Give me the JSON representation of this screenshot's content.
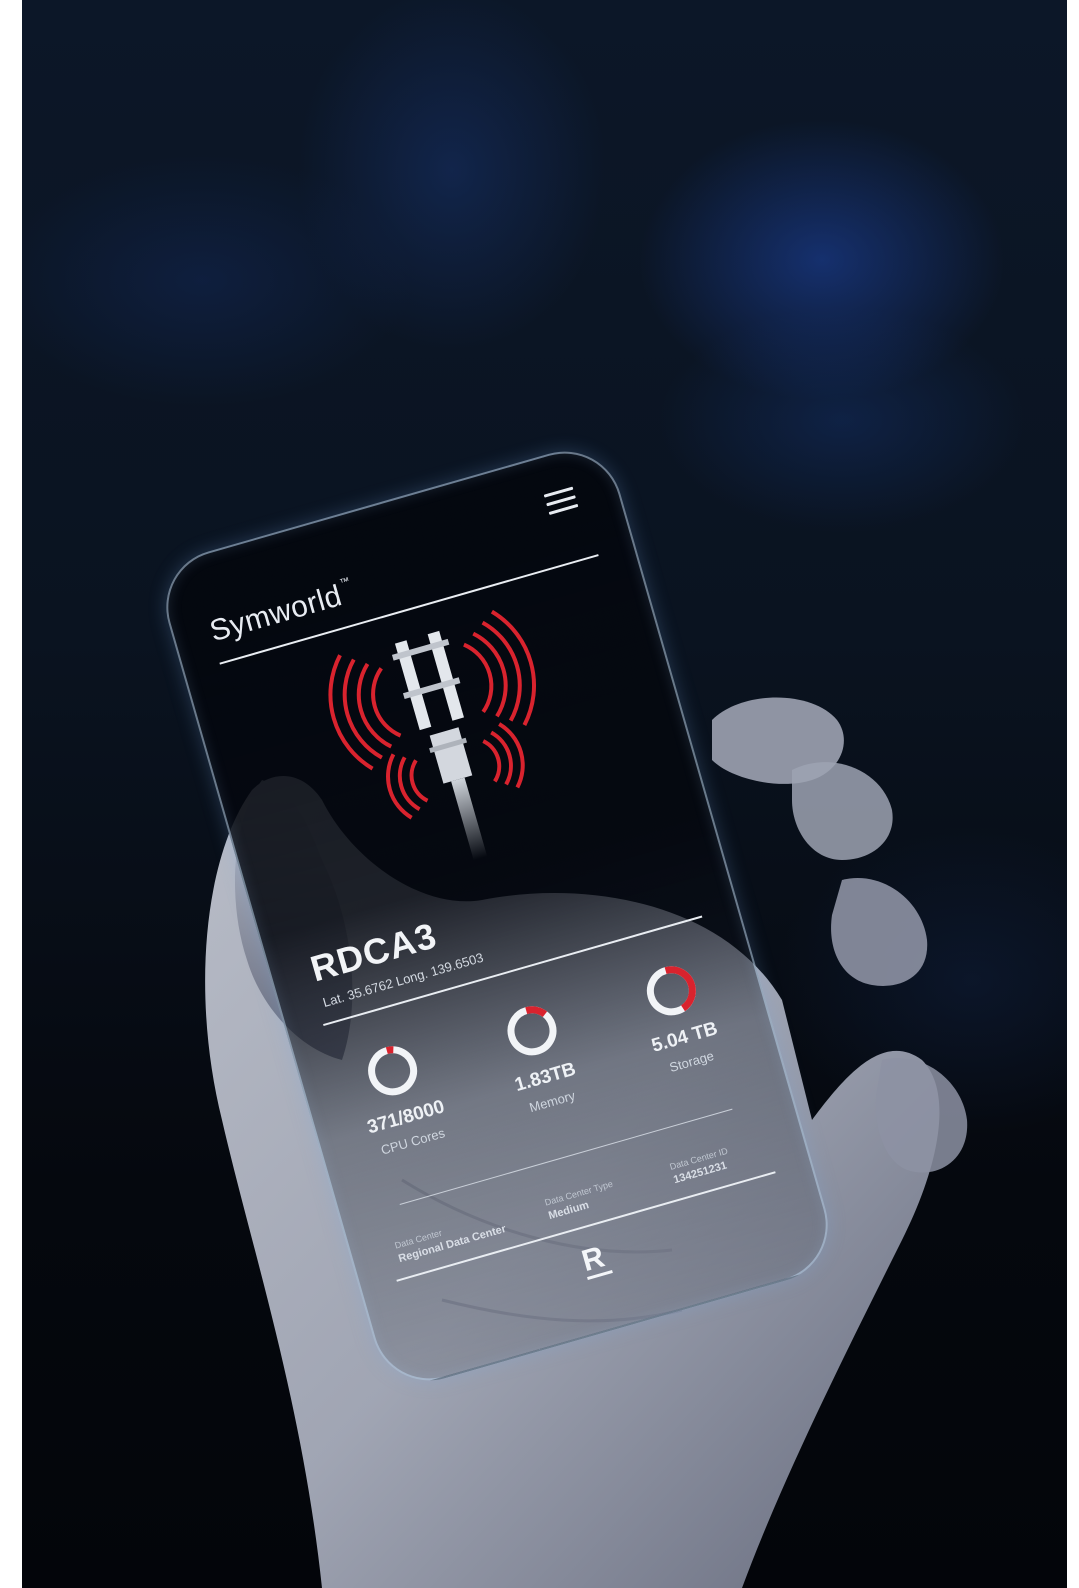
{
  "app": {
    "brand_name": "Symworld",
    "trademark": "™",
    "site_id": "RDCA3",
    "coordinates": "Lat. 35.6762  Long. 139.6503"
  },
  "metrics": [
    {
      "value_text": "371/8000",
      "label": "CPU Cores",
      "fraction": 0.05
    },
    {
      "value_text": "1.83TB",
      "label": "Memory",
      "fraction": 0.15
    },
    {
      "value_text": "5.04 TB",
      "label": "Storage",
      "fraction": 0.45
    }
  ],
  "details": {
    "data_center_label": "Data Center",
    "data_center_value": "Regional Data Center",
    "type_label": "Data Center Type",
    "type_value": "Medium",
    "id_label": "Data Center ID",
    "id_value": "134251231"
  },
  "footer": {
    "logo_letter": "R"
  },
  "colors": {
    "accent_red": "#d9232e",
    "ring_white": "#f2f4f7",
    "screen_dark": "#05080f"
  },
  "icons": {
    "menu": "hamburger-menu-icon",
    "tower": "cell-tower-icon"
  }
}
